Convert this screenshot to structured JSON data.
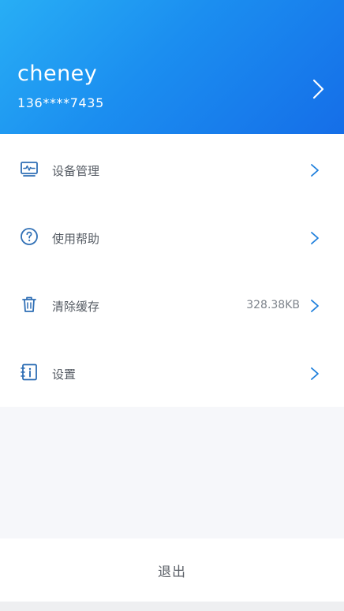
{
  "profile": {
    "username": "cheney",
    "phone": "136****7435",
    "chevron_icon": "chevron-right-icon"
  },
  "menu": {
    "items": [
      {
        "key": "device-management",
        "label": "设备管理",
        "value": "",
        "icon": "device-monitor-icon"
      },
      {
        "key": "help",
        "label": "使用帮助",
        "value": "",
        "icon": "help-circle-icon"
      },
      {
        "key": "clear-cache",
        "label": "清除缓存",
        "value": "328.38KB",
        "icon": "trash-icon"
      },
      {
        "key": "settings",
        "label": "设置",
        "value": "",
        "icon": "settings-doc-icon"
      }
    ]
  },
  "logout": {
    "label": "退出"
  },
  "colors": {
    "header_gradient_start": "#28aef5",
    "header_gradient_end": "#156ee8",
    "accent_blue": "#1e7fdc",
    "icon_blue": "#2f6fb5"
  }
}
